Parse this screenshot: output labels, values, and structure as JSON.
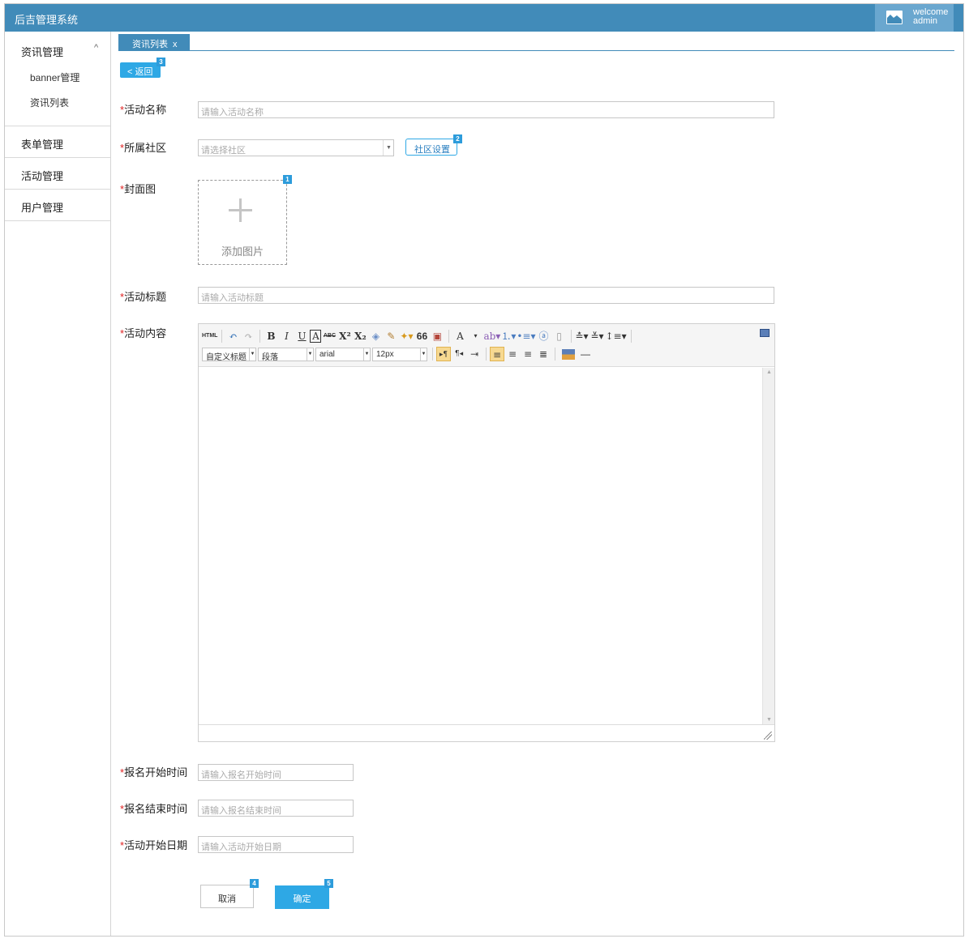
{
  "app": {
    "title": "后吉管理系统",
    "user_line1": "welcome",
    "user_line2": "admin"
  },
  "sidebar": {
    "group1": {
      "label": "资讯管理",
      "chevron": "^",
      "items": [
        {
          "label": "banner管理"
        },
        {
          "label": "资讯列表"
        }
      ]
    },
    "items": [
      {
        "label": "表单管理"
      },
      {
        "label": "活动管理"
      },
      {
        "label": "用户管理"
      }
    ]
  },
  "tabs": [
    {
      "label": "资讯列表",
      "close": "x"
    }
  ],
  "back": {
    "label": "< 返回",
    "badge": "3"
  },
  "form": {
    "required_mark": "*",
    "activity_name": {
      "label": "活动名称",
      "placeholder": "请输入活动名称"
    },
    "community": {
      "label": "所属社区",
      "placeholder": "请选择社区",
      "button": "社区设置",
      "badge": "2"
    },
    "cover": {
      "label": "封面图",
      "upload_text": "添加图片",
      "badge": "1"
    },
    "activity_title": {
      "label": "活动标题",
      "placeholder": "请输入活动标题"
    },
    "activity_content": {
      "label": "活动内容"
    },
    "signup_start": {
      "label": "报名开始时间",
      "placeholder": "请输入报名开始时间"
    },
    "signup_end": {
      "label": "报名结束时间",
      "placeholder": "请输入报名结束时间"
    },
    "activity_start": {
      "label": "活动开始日期",
      "placeholder": "请输入活动开始日期"
    }
  },
  "editor": {
    "html_label": "HTML",
    "bold": "B",
    "italic": "I",
    "underline": "U",
    "border": "A",
    "strike": "ABC",
    "superscript": "X²",
    "subscript": "X₂",
    "quote": "66",
    "fontcolor": "A",
    "custom_title": "自定义标题",
    "paragraph": "段落",
    "font": "arial",
    "size": "12px"
  },
  "actions": {
    "cancel": "取消",
    "cancel_badge": "4",
    "ok": "确定",
    "ok_badge": "5"
  },
  "colors": {
    "topbar": "#418bb9",
    "primary": "#2ea8e5",
    "required": "#e02020"
  }
}
